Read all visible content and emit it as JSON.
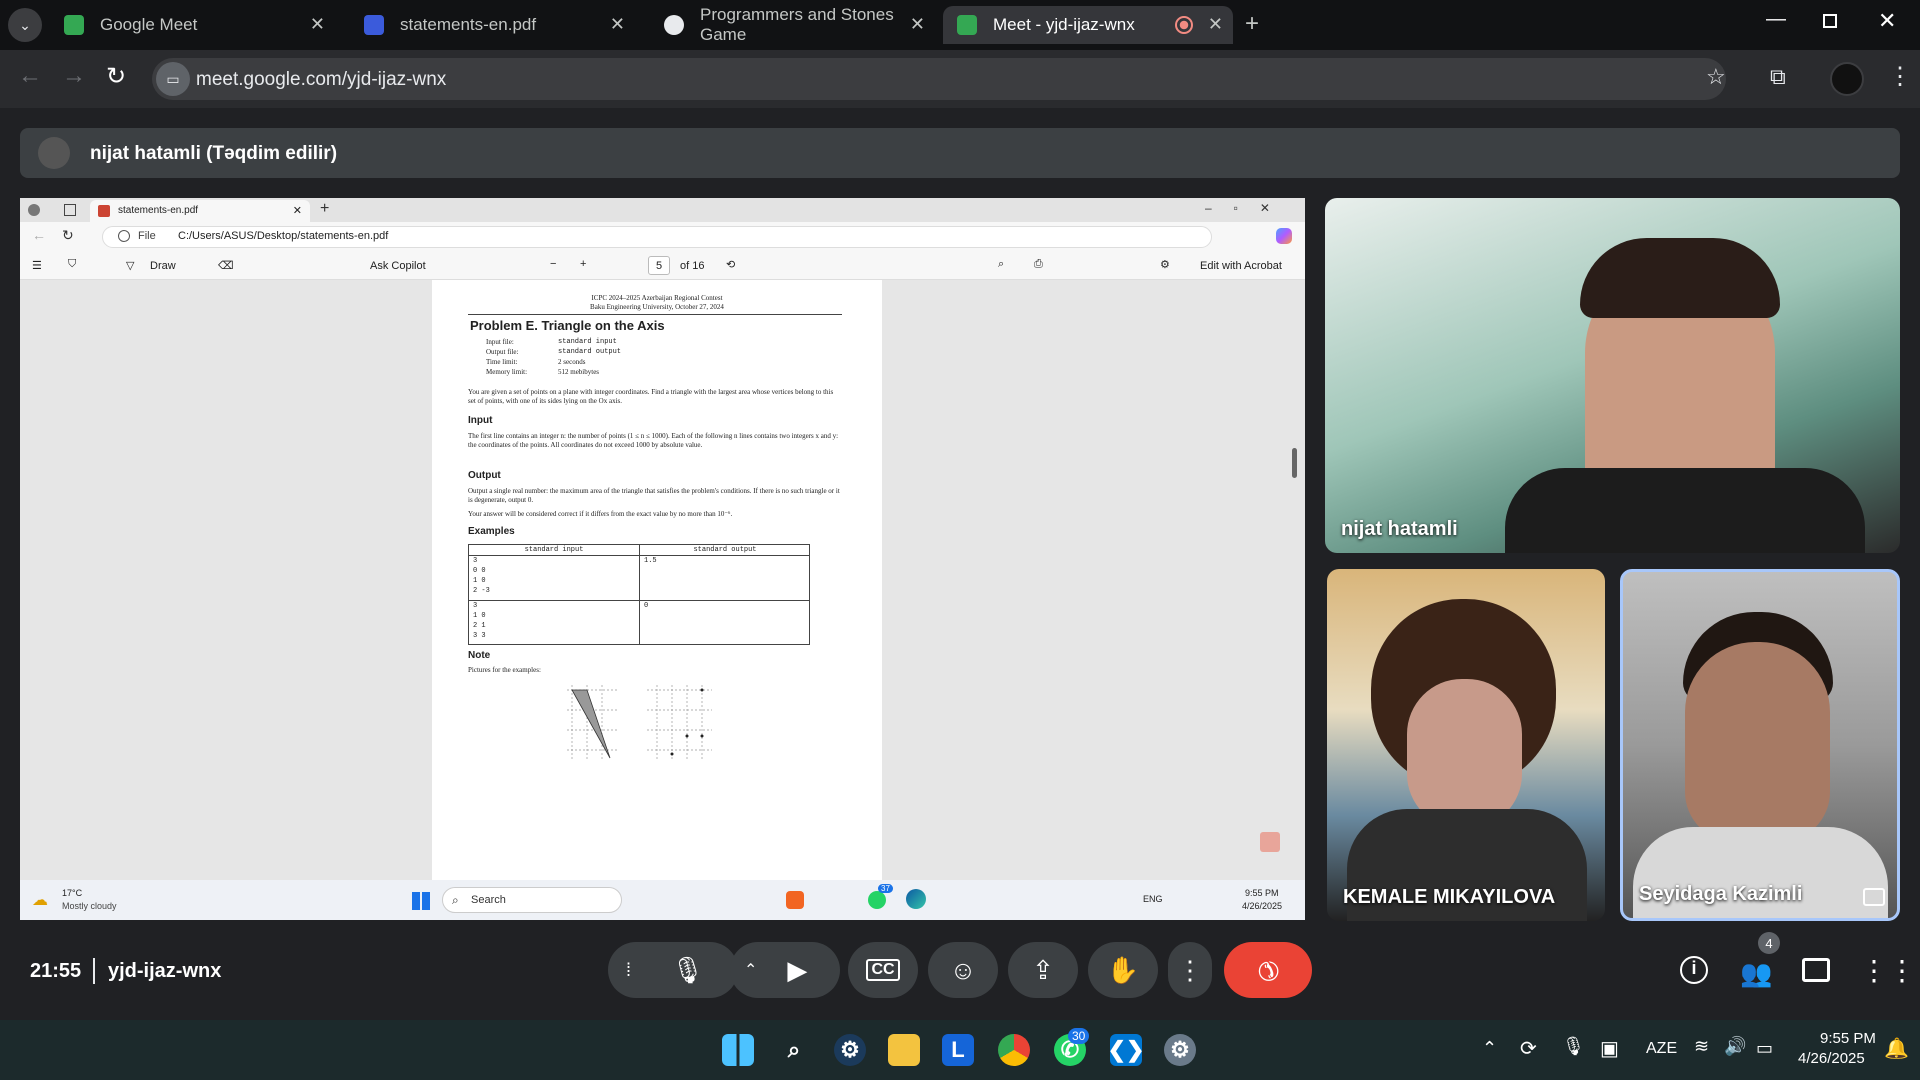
{
  "browser": {
    "tabs": [
      {
        "label": "Google Meet",
        "color": "#34a853"
      },
      {
        "label": "statements-en.pdf",
        "color": "#3b5bdb"
      },
      {
        "label": "Programmers and Stones Game",
        "color": "#e8eaed"
      },
      {
        "label": "Meet - yjd-ijaz-wnx",
        "color": "#34a853"
      }
    ],
    "url": "meet.google.com/yjd-ijaz-wnx"
  },
  "meet": {
    "presenter": "nijat hatamli (Təqdim edilir)",
    "time": "21:55",
    "meeting_code": "yjd-ijaz-wnx",
    "participants_count": "4",
    "tiles": [
      {
        "name": "nijat hatamli"
      },
      {
        "name": "KEMALE MIKAYILOVA"
      },
      {
        "name": "Seyidaga Kazimli"
      }
    ]
  },
  "pdf": {
    "tab": "statements-en.pdf",
    "file_label": "File",
    "path": "C:/Users/ASUS/Desktop/statements-en.pdf",
    "draw": "Draw",
    "ask_copilot": "Ask Copilot",
    "page": "5",
    "of": "of 16",
    "edit_acrobat": "Edit with Acrobat",
    "header1": "ICPC 2024–2025 Azerbaijan Regional Contest",
    "header2": "Baku Engineering University, October 27, 2024",
    "title": "Problem E. Triangle on the Axis",
    "meta": [
      [
        "Input file:",
        "standard input"
      ],
      [
        "Output file:",
        "standard output"
      ],
      [
        "Time limit:",
        "2 seconds"
      ],
      [
        "Memory limit:",
        "512 mebibytes"
      ]
    ],
    "intro": "You are given a set of points on a plane with integer coordinates. Find a triangle with the largest area whose vertices belong to this set of points, with one of its sides lying on the Ox axis.",
    "input_h": "Input",
    "input_t": "The first line contains an integer n: the number of points (1 ≤ n ≤ 1000). Each of the following n lines contains two integers x and y: the coordinates of the points. All coordinates do not exceed 1000 by absolute value.",
    "output_h": "Output",
    "output_t": "Output a single real number: the maximum area of the triangle that satisfies the problem's conditions. If there is no such triangle or it is degenerate, output 0.",
    "output_t2": "Your answer will be considered correct if it differs from the exact value by no more than 10⁻⁶.",
    "examples_h": "Examples",
    "table_head": [
      "standard input",
      "standard output"
    ],
    "ex1_in": [
      "3",
      "0 0",
      "1 0",
      "2 -3"
    ],
    "ex1_out": "1.5",
    "ex2_in": [
      "3",
      "1 0",
      "2 1",
      "3 3"
    ],
    "ex2_out": "0",
    "note_h": "Note",
    "note_t": "Pictures for the examples:"
  },
  "inner_taskbar": {
    "temp": "17°C",
    "weather": "Mostly cloudy",
    "search": "Search",
    "lang": "ENG",
    "time": "9:55 PM",
    "date": "4/26/2025",
    "badge": "37"
  },
  "taskbar": {
    "lang": "AZE",
    "time": "9:55 PM",
    "date": "4/26/2025",
    "whatsapp_badge": "30"
  }
}
